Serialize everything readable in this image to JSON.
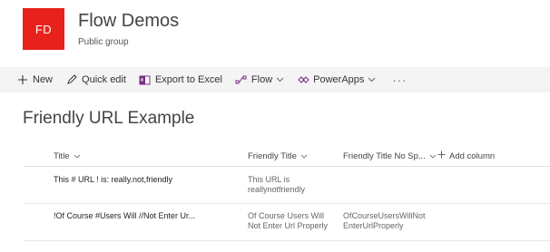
{
  "site": {
    "logo_initials": "FD",
    "logo_color": "#e8211c",
    "title": "Flow Demos",
    "subtitle": "Public group"
  },
  "command_bar": {
    "items": [
      {
        "label": "New",
        "icon": "plus-icon"
      },
      {
        "label": "Quick edit",
        "icon": "pencil-icon"
      },
      {
        "label": "Export to Excel",
        "icon": "excel-icon"
      },
      {
        "label": "Flow",
        "icon": "flow-icon",
        "has_dropdown": true
      },
      {
        "label": "PowerApps",
        "icon": "powerapps-icon",
        "has_dropdown": true
      }
    ],
    "more_label": "···"
  },
  "list": {
    "title": "Friendly URL Example",
    "columns": [
      {
        "label": "Title"
      },
      {
        "label": "Friendly Title"
      },
      {
        "label": "Friendly Title No Sp..."
      }
    ],
    "add_column_label": "Add column",
    "rows": [
      {
        "title": "This # URL ! is: really.not,friendly",
        "friendly_title": "This URL is reallynotfriendly",
        "friendly_title_nosp": ""
      },
      {
        "title": "!Of Course #Users Will //Not Enter Ur...",
        "friendly_title": "Of Course Users Will Not Enter Url Properly",
        "friendly_title_nosp": "OfCourseUsersWillNotEnterUrlProperly"
      }
    ]
  }
}
